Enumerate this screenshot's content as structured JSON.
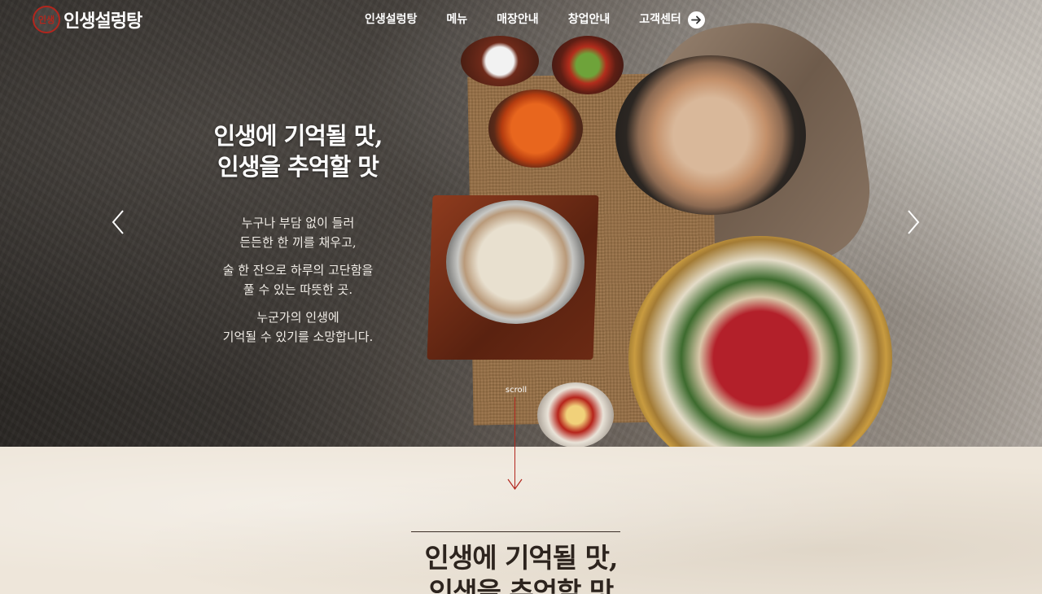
{
  "brand": {
    "logo_mark": "인생",
    "logo_text": "인생설렁탕",
    "accent_color": "#b2261d"
  },
  "nav": {
    "items": [
      "인생설렁탕",
      "메뉴",
      "매장안내",
      "창업안내",
      "고객센터"
    ],
    "more_icon": "arrow-right-circle-icon"
  },
  "hero": {
    "title_line1": "인생에 기억될 맛,",
    "title_line2": "인생을 추억할 맛",
    "para1_line1": "누구나 부담 없이 들러",
    "para1_line2": "든든한 한 끼를 채우고,",
    "para2_line1": "술 한 잔으로 하루의 고단함을",
    "para2_line2": "풀 수 있는 따뜻한 곳.",
    "para3_line1": "누군가의 인생에",
    "para3_line2": "기억될 수 있기를 소망합니다.",
    "prev_icon": "chevron-left-icon",
    "next_icon": "chevron-right-icon",
    "prev_glyph": "‹",
    "next_glyph": "›",
    "scroll_label": "scroll"
  },
  "lower": {
    "title_line1": "인생에 기억될 맛,",
    "title_line2": "인생을 추억할 맛"
  }
}
